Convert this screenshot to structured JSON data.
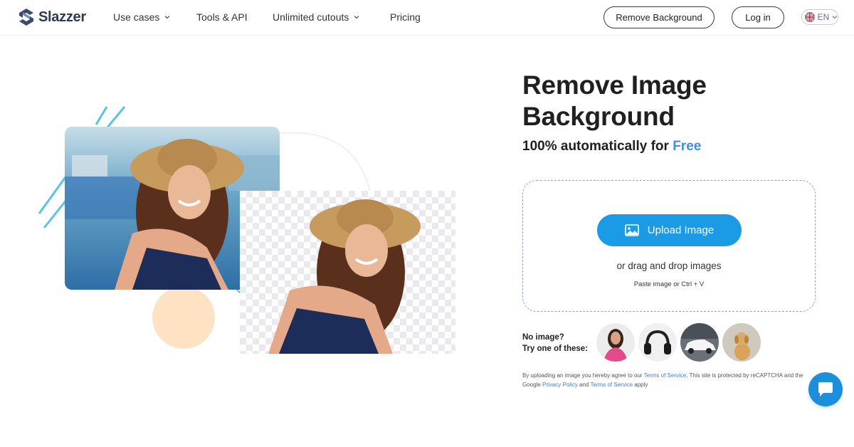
{
  "header": {
    "logo_text": "Slazzer",
    "nav": [
      {
        "label": "Use cases",
        "has_dropdown": true
      },
      {
        "label": "Tools & API",
        "has_dropdown": false
      },
      {
        "label": "Unlimited cutouts",
        "has_dropdown": true
      },
      {
        "label": "Pricing",
        "has_dropdown": false
      }
    ],
    "remove_bg_label": "Remove Background",
    "login_label": "Log in",
    "language": "EN"
  },
  "hero": {
    "title": "Remove Image Background",
    "subtitle_prefix": "100% automatically for ",
    "subtitle_highlight": "Free"
  },
  "upload": {
    "button_label": "Upload Image",
    "drag_text": "or drag and drop images",
    "paste_text": "Paste image or Ctrl + V"
  },
  "samples": {
    "prompt_line1": "No image?",
    "prompt_line2": "Try one of these:",
    "items": [
      "woman",
      "headphones",
      "car",
      "dog"
    ]
  },
  "legal": {
    "part1": "By uploading an image you hereby agree to our ",
    "tos_link": "Terms of Service",
    "part2": ". This site is protected by reCAPTCHA and the Google ",
    "privacy_link": "Privacy Policy",
    "part3": " and ",
    "terms_link": "Terms of Service",
    "part4": " apply"
  },
  "colors": {
    "accent": "#1b9be6",
    "free_highlight": "#3f8ee8",
    "peach": "#fde3c4"
  }
}
